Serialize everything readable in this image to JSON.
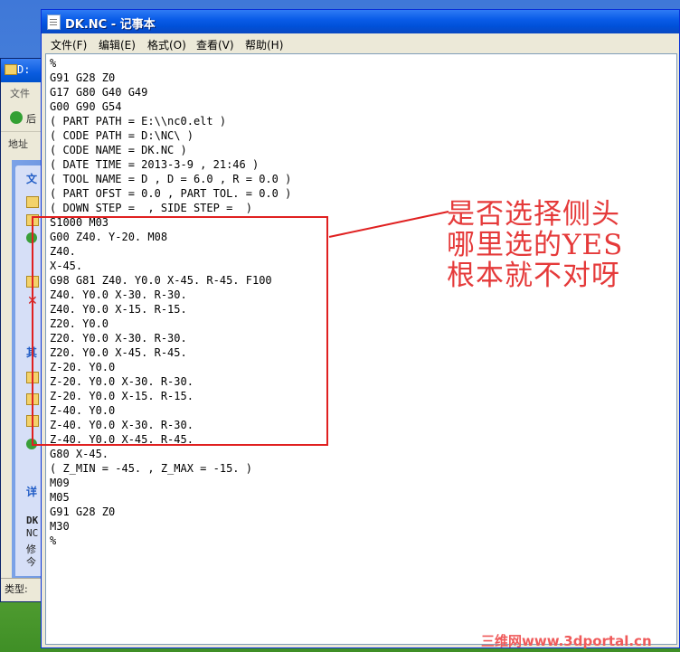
{
  "notepad": {
    "title": "DK.NC - 记事本",
    "menu": [
      "文件(F)",
      "编辑(E)",
      "格式(O)",
      "查看(V)",
      "帮助(H)"
    ],
    "lines": [
      "%",
      "G91 G28 Z0",
      "G17 G80 G40 G49",
      "G00 G90 G54",
      "( PART PATH = E:\\\\nc0.elt )",
      "( CODE PATH = D:\\NC\\ )",
      "( CODE NAME = DK.NC )",
      "( DATE TIME = 2013-3-9 , 21:46 )",
      "( TOOL NAME = D , D = 6.0 , R = 0.0 )",
      "( PART OFST = 0.0 , PART TOL. = 0.0 )",
      "( DOWN STEP =  , SIDE STEP =  )",
      "S1000 M03",
      "G00 Z40. Y-20. M08",
      "Z40.",
      "X-45.",
      "G98 G81 Z40. Y0.0 X-45. R-45. F100",
      "Z40. Y0.0 X-30. R-30.",
      "Z40. Y0.0 X-15. R-15.",
      "Z20. Y0.0",
      "Z20. Y0.0 X-30. R-30.",
      "Z20. Y0.0 X-45. R-45.",
      "Z-20. Y0.0",
      "Z-20. Y0.0 X-30. R-30.",
      "Z-20. Y0.0 X-15. R-15.",
      "Z-40. Y0.0",
      "Z-40. Y0.0 X-30. R-30.",
      "Z-40. Y0.0 X-45. R-45.",
      "G80 X-45.",
      "( Z_MIN = -45. , Z_MAX = -15. )",
      "M09",
      "M05",
      "G91 G28 Z0",
      "M30",
      "%"
    ]
  },
  "explorer": {
    "title": "D:",
    "menu_file": "文件",
    "back": "后",
    "address": "地址",
    "panel1": "文",
    "panel2": "其",
    "panel3": "详",
    "detail_name": "DK",
    "detail_type": "NC",
    "detail_mod": "修",
    "detail_today": "今",
    "status": "类型:"
  },
  "annotation": {
    "lines": [
      "是否选择侧头",
      "哪里选的YES",
      "根本就不对呀"
    ],
    "color": "#e53a3a"
  },
  "watermark": "三维网www.3dportal.cn"
}
